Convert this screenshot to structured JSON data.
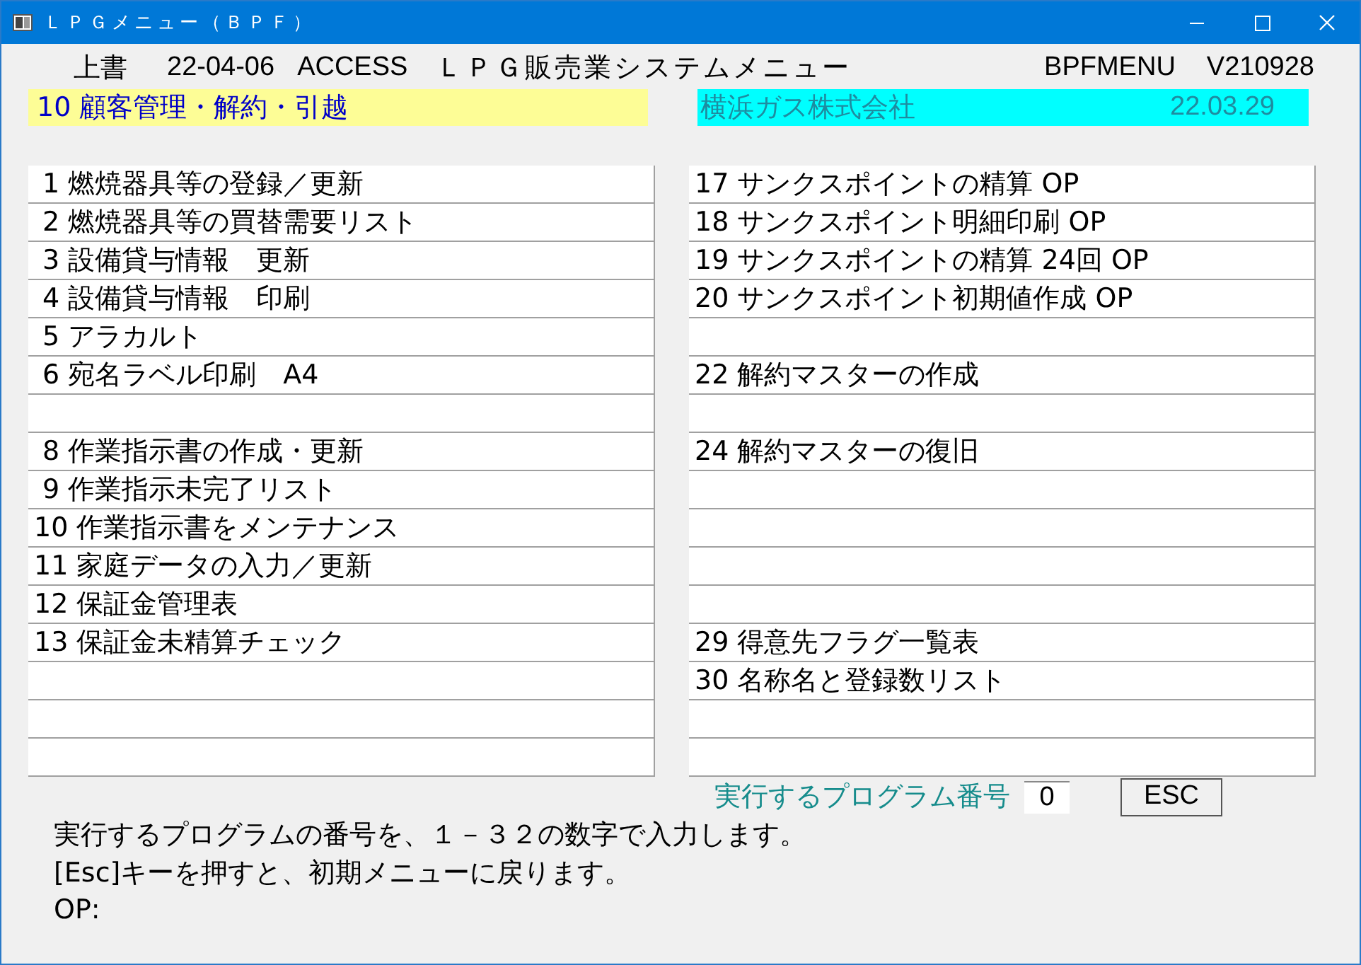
{
  "window": {
    "title": "ＬＰＧメニュー（ＢＰＦ）"
  },
  "header": {
    "mode": "上書",
    "date": "22-04-06",
    "db": "ACCESS",
    "title": "ＬＰＧ販売業システムメニュー",
    "program": "BPFMENU",
    "version": "V210928"
  },
  "section": "10 顧客管理・解約・引越",
  "company": {
    "name": "横浜ガス株式会社",
    "date": "22.03.29"
  },
  "left_items": [
    {
      "kind": "item",
      "label": " 1 燃焼器具等の登録／更新"
    },
    {
      "kind": "item",
      "label": " 2 燃焼器具等の買替需要リスト"
    },
    {
      "kind": "item",
      "label": " 3 設備貸与情報　更新"
    },
    {
      "kind": "item",
      "label": " 4 設備貸与情報　印刷"
    },
    {
      "kind": "item",
      "label": " 5 アラカルト"
    },
    {
      "kind": "item",
      "label": " 6 宛名ラベル印刷　A4"
    },
    {
      "kind": "blank"
    },
    {
      "kind": "item",
      "label": " 8 作業指示書の作成・更新"
    },
    {
      "kind": "item",
      "label": " 9 作業指示未完了リスト"
    },
    {
      "kind": "item",
      "label": "10 作業指示書をメンテナンス"
    },
    {
      "kind": "item",
      "label": "11 家庭データの入力／更新"
    },
    {
      "kind": "item",
      "label": "12 保証金管理表"
    },
    {
      "kind": "item",
      "label": "13 保証金未精算チェック"
    },
    {
      "kind": "blank"
    },
    {
      "kind": "blank"
    },
    {
      "kind": "blank"
    }
  ],
  "right_items": [
    {
      "kind": "item",
      "label": "17 サンクスポイントの精算 OP"
    },
    {
      "kind": "item",
      "label": "18 サンクスポイント明細印刷 OP"
    },
    {
      "kind": "item",
      "label": "19 サンクスポイントの精算 24回 OP"
    },
    {
      "kind": "item",
      "label": "20 サンクスポイント初期値作成 OP"
    },
    {
      "kind": "blank"
    },
    {
      "kind": "item",
      "label": "22 解約マスターの作成"
    },
    {
      "kind": "blank"
    },
    {
      "kind": "item",
      "label": "24 解約マスターの復旧"
    },
    {
      "kind": "blank"
    },
    {
      "kind": "blank"
    },
    {
      "kind": "blank"
    },
    {
      "kind": "blank"
    },
    {
      "kind": "item",
      "label": "29 得意先フラグ一覧表"
    },
    {
      "kind": "item",
      "label": "30 名称名と登録数リスト"
    },
    {
      "kind": "blank"
    },
    {
      "kind": "blank"
    }
  ],
  "prompt": {
    "label": "実行するプログラム番号",
    "value": "0",
    "button": "ESC"
  },
  "help": [
    "実行するプログラムの番号を、１－３２の数字で入力します。",
    "[Esc]キーを押すと、初期メニューに戻ります。",
    "OP:"
  ]
}
